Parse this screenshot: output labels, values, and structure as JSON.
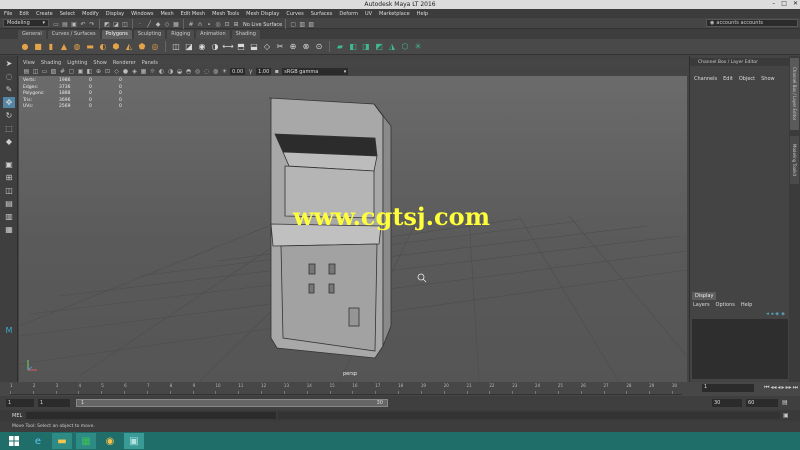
{
  "window": {
    "title": "Autodesk Maya LT 2016",
    "controls": [
      "–",
      "□",
      "✕"
    ]
  },
  "menubar": [
    "File",
    "Edit",
    "Create",
    "Select",
    "Modify",
    "Display",
    "Windows",
    "Mesh",
    "Edit Mesh",
    "Mesh Tools",
    "Mesh Display",
    "Curves",
    "Surfaces",
    "Deform",
    "UV",
    "Marketplace",
    "Help"
  ],
  "statusline": {
    "mode": "Modeling",
    "live_surface": "No Live Surface",
    "account": "accounts accounts"
  },
  "shelf_tabs": [
    {
      "label": "General",
      "active": false
    },
    {
      "label": "Curves / Surfaces",
      "active": false
    },
    {
      "label": "Polygons",
      "active": true
    },
    {
      "label": "Sculpting",
      "active": false
    },
    {
      "label": "Rigging",
      "active": false
    },
    {
      "label": "Animation",
      "active": false
    },
    {
      "label": "Shading",
      "active": false
    }
  ],
  "panel_menu": [
    "View",
    "Shading",
    "Lighting",
    "Show",
    "Renderer",
    "Panels"
  ],
  "panel_toolbar": {
    "exposure": "0.00",
    "gamma": "1.00",
    "color_space": "sRGB gamma"
  },
  "hud": {
    "rows": [
      {
        "label": "Verts:",
        "a": "1986",
        "b": "0",
        "c": "0"
      },
      {
        "label": "Edges:",
        "a": "3736",
        "b": "0",
        "c": "0"
      },
      {
        "label": "Polygons:",
        "a": "1888",
        "b": "0",
        "c": "0"
      },
      {
        "label": "Tris:",
        "a": "3696",
        "b": "0",
        "c": "0"
      },
      {
        "label": "UVs:",
        "a": "2569",
        "b": "0",
        "c": "0"
      }
    ]
  },
  "viewport": {
    "camera": "persp",
    "watermark": "www.cgtsj.com"
  },
  "channel_box": {
    "header": "Channel Box / Layer Editor",
    "menu": [
      "Channels",
      "Edit",
      "Object",
      "Show"
    ],
    "layer_tab": "Display",
    "layer_menu": [
      "Layers",
      "Options",
      "Help"
    ]
  },
  "side_tabs": [
    "Channel Box / Layer Editor",
    "Modeling Toolkit"
  ],
  "timeslider": {
    "ticks": [
      "1",
      "2",
      "3",
      "4",
      "5",
      "6",
      "7",
      "8",
      "9",
      "10",
      "11",
      "12",
      "13",
      "14",
      "15",
      "16",
      "17",
      "18",
      "19",
      "20",
      "21",
      "22",
      "23",
      "24",
      "25",
      "26",
      "27",
      "28",
      "29",
      "30"
    ],
    "current": "1"
  },
  "range": {
    "start": "1",
    "inner_start": "1",
    "bar_start": "1",
    "bar_end": "30",
    "inner_end": "30",
    "end": "60"
  },
  "cmdline": {
    "lang": "MEL"
  },
  "helpline": "Move Tool: Select an object to move."
}
